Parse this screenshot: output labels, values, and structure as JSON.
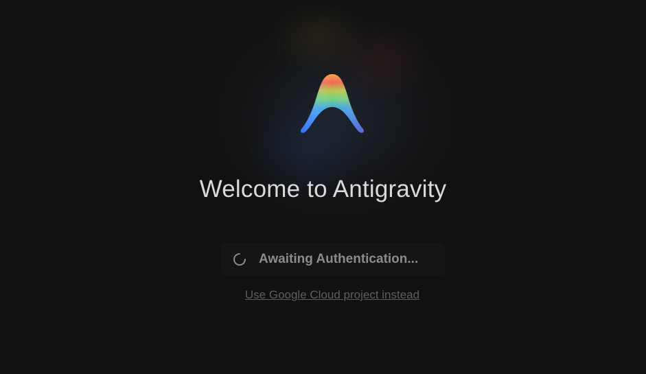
{
  "welcome": {
    "title": "Welcome to Antigravity",
    "status_text": "Awaiting Authentication...",
    "alt_link_label": "Use Google Cloud project instead"
  },
  "icons": {
    "logo": "antigravity-logo",
    "spinner": "loading-spinner-icon"
  },
  "colors": {
    "background": "#111111",
    "title": "#d9d9d9",
    "status_text": "#8b8b8b",
    "status_box": "#151515",
    "link": "#5e5e5e",
    "logo_gradient": [
      "#f2c14e",
      "#ea6a4f",
      "#8fd36b",
      "#3f8cf7",
      "#2f6df5"
    ]
  }
}
